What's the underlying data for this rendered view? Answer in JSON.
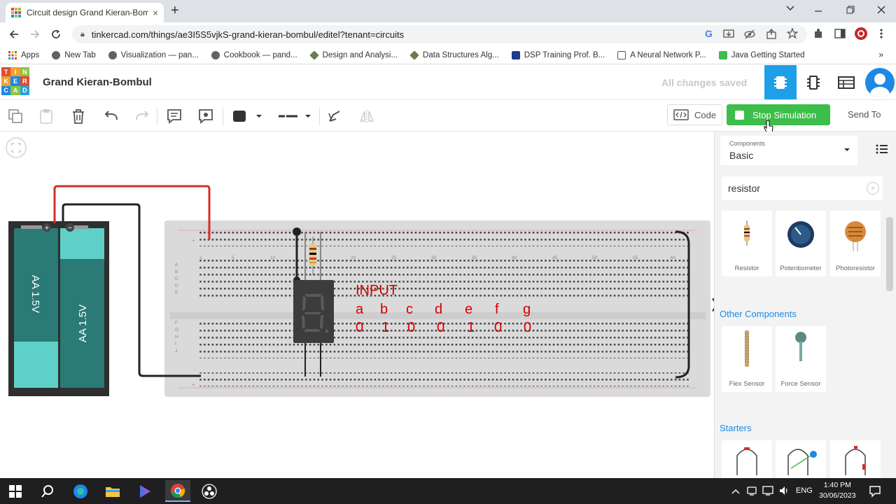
{
  "browser": {
    "tab_title": "Circuit design Grand Kieran-Bom",
    "tab_close": "×",
    "new_tab": "+",
    "url": "tinkercad.com/things/ae3I5S5vjkS-grand-kieran-bombul/editel?tenant=circuits",
    "bookmarks": [
      {
        "label": "Apps",
        "color": "#e94235"
      },
      {
        "label": "New Tab",
        "color": "#5f6368"
      },
      {
        "label": "Visualization — pan...",
        "color": "#5f6368"
      },
      {
        "label": "Cookbook — pand...",
        "color": "#5f6368"
      },
      {
        "label": "Design and Analysi...",
        "color": "#6b7d4f"
      },
      {
        "label": "Data Structures Alg...",
        "color": "#6b7d4f"
      },
      {
        "label": "DSP Training Prof. B...",
        "color": "#1b3b8c"
      },
      {
        "label": "A Neural Network P...",
        "color": "#555555"
      },
      {
        "label": "Java Getting Started",
        "color": "#3dbd4a"
      }
    ],
    "bookmarks_more": "»"
  },
  "logo": {
    "letters": [
      "T",
      "I",
      "N",
      "K",
      "E",
      "R",
      "C",
      "A",
      "D"
    ],
    "colors": [
      "#e24b36",
      "#f3a02a",
      "#8cc63f",
      "#f3a02a",
      "#1e88e5",
      "#e24b36",
      "#1e88e5",
      "#8cc63f",
      "#29a3d9"
    ]
  },
  "header": {
    "project_title": "Grand Kieran-Bombul",
    "save_status": "All changes saved"
  },
  "toolbar": {
    "code_label": "Code",
    "stop_label": "Stop Simulation",
    "send_to_label": "Send To"
  },
  "circuit": {
    "battery_label_1": "AA 1.5V",
    "battery_label_2": "AA 1.5V",
    "plus_sign": "+",
    "minus_sign": "−",
    "input_title": "INPUT",
    "segments": [
      "a",
      "b",
      "c",
      "d",
      "e",
      "f",
      "g"
    ],
    "values": [
      "0",
      "1",
      "0",
      "0",
      "1",
      "0",
      "0"
    ],
    "column_numbers": [
      "1",
      "5",
      "10",
      "15",
      "20",
      "25",
      "30",
      "35",
      "40",
      "45",
      "50",
      "55",
      "60"
    ],
    "row_letters_top": [
      "A",
      "B",
      "C",
      "D",
      "E"
    ],
    "row_letters_bottom": [
      "F",
      "G",
      "H",
      "I",
      "J"
    ],
    "digit_shown": "8"
  },
  "panel": {
    "components_label": "Components",
    "components_value": "Basic",
    "search_value": "resistor",
    "search_clear": "×",
    "cards_top": [
      "Resistor",
      "Potentiometer",
      "Photoresistor"
    ],
    "other_components_label": "Other Components",
    "cards_other": [
      "Flex Sensor",
      "Force Sensor"
    ],
    "starters_label": "Starters",
    "toggle_glyph": "❯"
  },
  "taskbar": {
    "language": "ENG",
    "time": "1:40 PM",
    "date": "30/06/2023"
  }
}
